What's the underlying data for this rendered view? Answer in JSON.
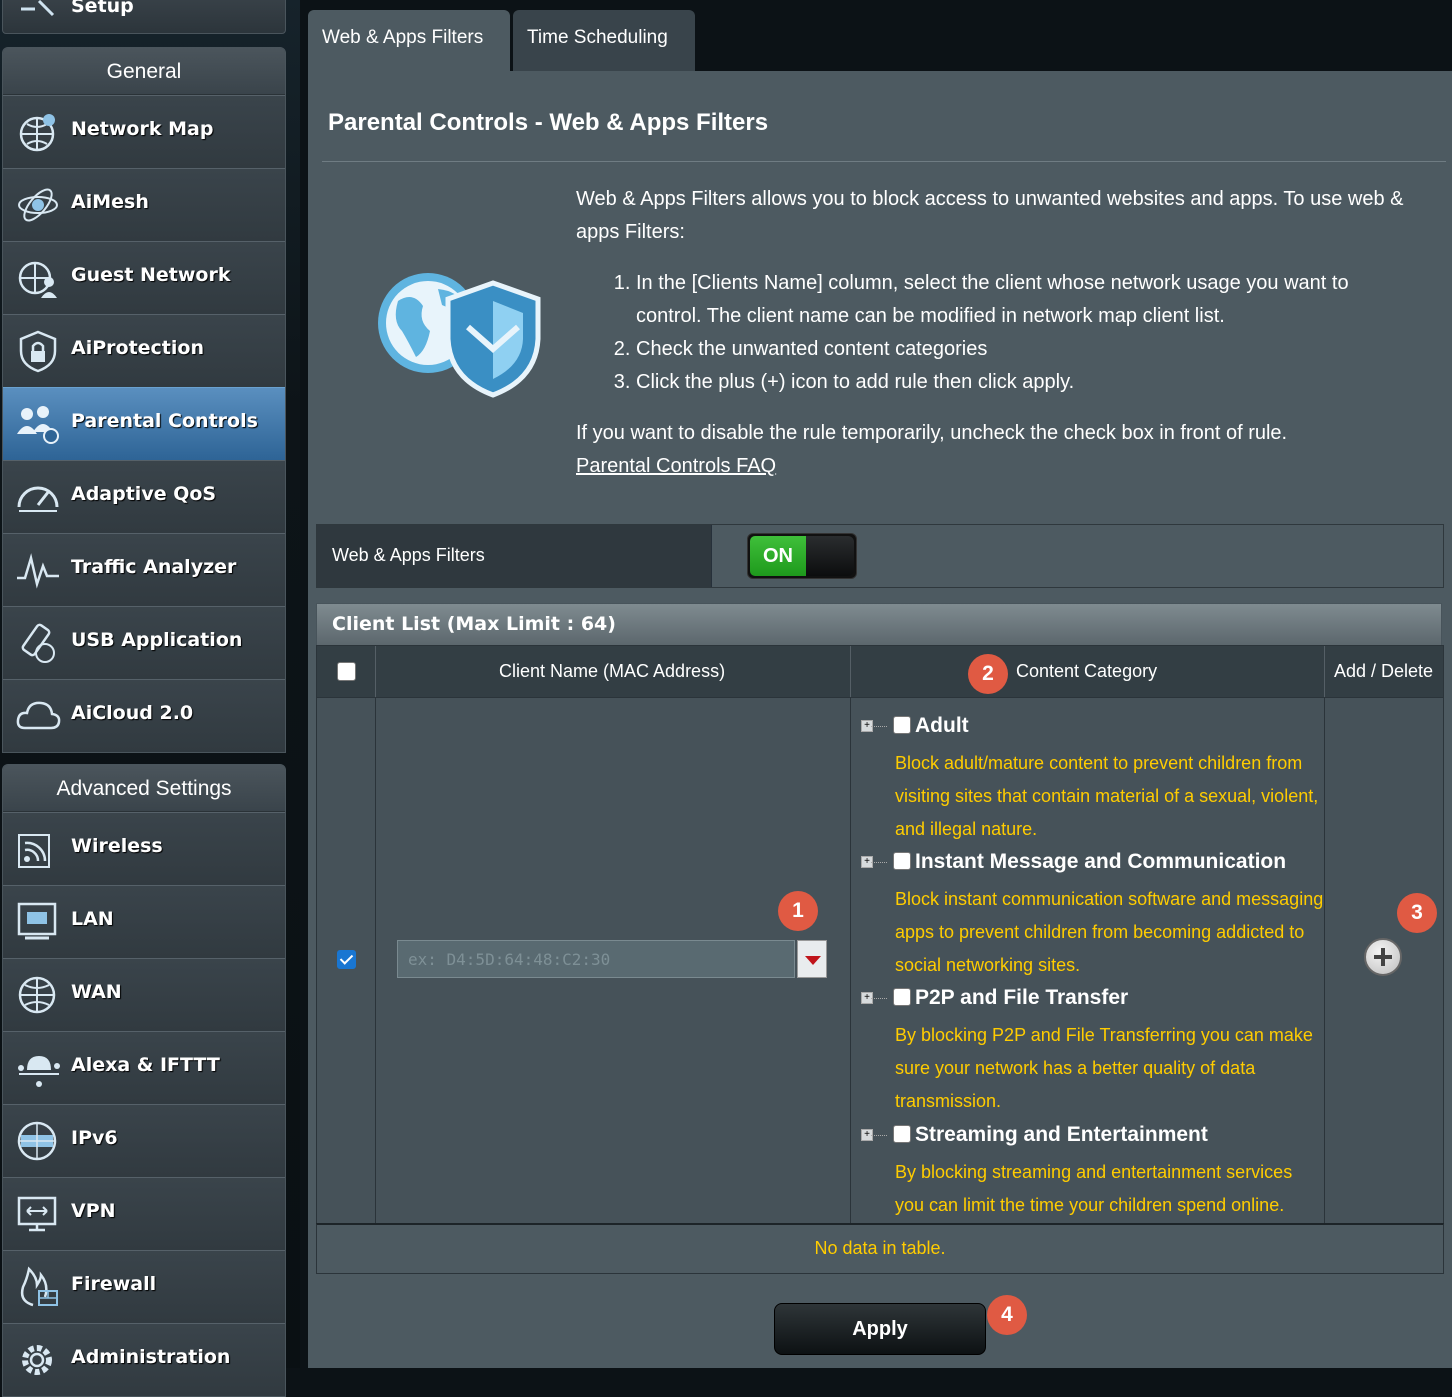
{
  "sidebar": {
    "top_item": {
      "label": "Setup",
      "icon": "setup-icon"
    },
    "general": {
      "heading": "General",
      "items": [
        {
          "label": "Network Map",
          "icon": "globe-network-icon"
        },
        {
          "label": "AiMesh",
          "icon": "aimesh-icon"
        },
        {
          "label": "Guest Network",
          "icon": "guest-network-icon"
        },
        {
          "label": "AiProtection",
          "icon": "shield-lock-icon"
        },
        {
          "label": "Parental Controls",
          "icon": "family-icon"
        },
        {
          "label": "Adaptive QoS",
          "icon": "gauge-icon"
        },
        {
          "label": "Traffic Analyzer",
          "icon": "traffic-icon"
        },
        {
          "label": "USB Application",
          "icon": "usb-icon"
        },
        {
          "label": "AiCloud 2.0",
          "icon": "cloud-icon"
        }
      ]
    },
    "advanced": {
      "heading": "Advanced Settings",
      "items": [
        {
          "label": "Wireless",
          "icon": "wifi-icon"
        },
        {
          "label": "LAN",
          "icon": "lan-icon"
        },
        {
          "label": "WAN",
          "icon": "globe-icon"
        },
        {
          "label": "Alexa & IFTTT",
          "icon": "alexa-icon"
        },
        {
          "label": "IPv6",
          "icon": "ipv6-icon"
        },
        {
          "label": "VPN",
          "icon": "vpn-icon"
        },
        {
          "label": "Firewall",
          "icon": "firewall-icon"
        },
        {
          "label": "Administration",
          "icon": "gear-icon"
        }
      ]
    }
  },
  "tabs": {
    "web_apps": "Web & Apps Filters",
    "time_scheduling": "Time Scheduling"
  },
  "page": {
    "title": "Parental Controls - Web & Apps Filters",
    "intro": "Web & Apps Filters allows you to block access to unwanted websites and apps. To use web & apps Filters:",
    "steps": [
      "In the [Clients Name] column, select the client whose network usage you want to control. The client name can be modified in network map client list.",
      "Check the unwanted content categories",
      "Click the plus (+) icon to add rule then click apply."
    ],
    "disable_note": "If you want to disable the rule temporarily, uncheck the check box in front of rule.",
    "faq_link": "Parental Controls FAQ"
  },
  "toggle": {
    "label": "Web & Apps Filters",
    "state": "ON"
  },
  "client_list": {
    "title": "Client List (Max Limit : 64)",
    "columns": {
      "client": "Client Name (MAC Address)",
      "category": "Content Category",
      "add_delete": "Add / Delete"
    },
    "mac_placeholder": "ex: D4:5D:64:48:C2:30",
    "categories": [
      {
        "title": "Adult",
        "desc": "Block adult/mature content to prevent children from visiting sites that contain material of a sexual, violent, and illegal nature."
      },
      {
        "title": "Instant Message and Communication",
        "desc": "Block instant communication software and messaging apps to prevent children from becoming addicted to social networking sites."
      },
      {
        "title": "P2P and File Transfer",
        "desc": "By blocking P2P and File Transferring you can make sure your network has a better quality of data transmission."
      },
      {
        "title": "Streaming and Entertainment",
        "desc": "By blocking streaming and entertainment services you can limit the time your children spend online."
      }
    ],
    "empty": "No data in table."
  },
  "apply_label": "Apply",
  "badges": [
    "1",
    "2",
    "3",
    "4"
  ],
  "colors": {
    "accent": "#e05a43",
    "warning_text": "#ffcc00",
    "toggle_on": "#2fae2b",
    "active_menu": "#3f78ab"
  }
}
